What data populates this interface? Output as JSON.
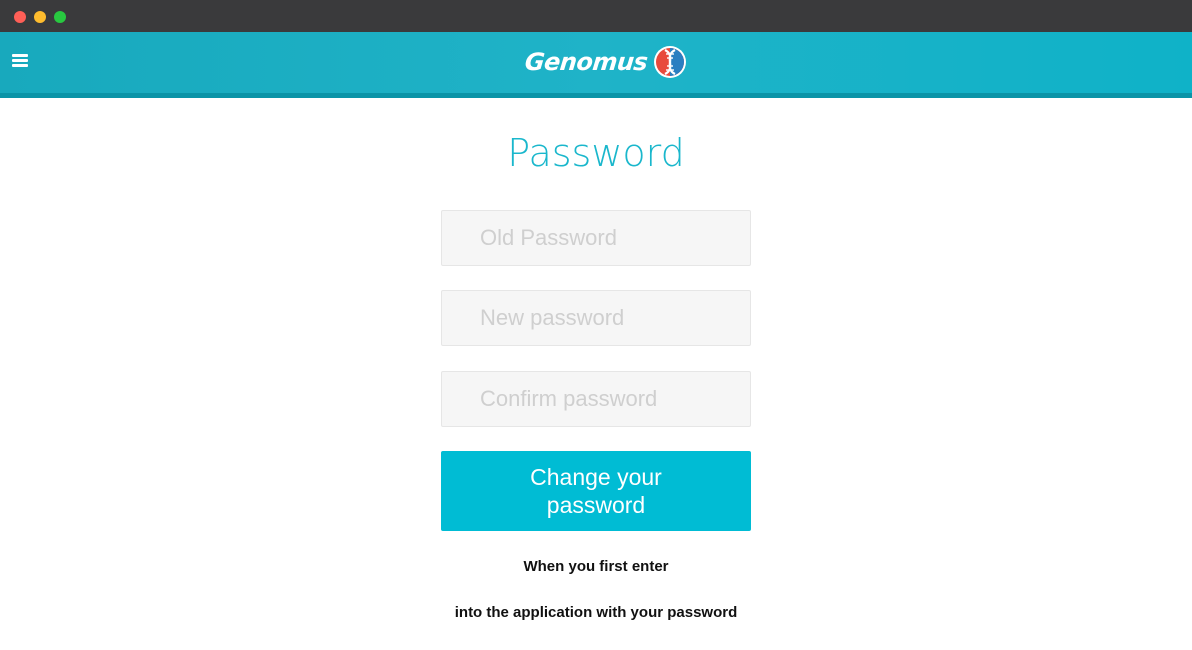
{
  "window": {
    "controls": [
      "close",
      "minimize",
      "maximize"
    ]
  },
  "header": {
    "menu_icon": "hamburger-menu-icon",
    "brand": "Genomus",
    "brand_icon": "dna-icon",
    "color": "#1fb3c8"
  },
  "form": {
    "title": "Password",
    "old_password_placeholder": "Old Password",
    "new_password_placeholder": "New password",
    "confirm_password_placeholder": "Confirm password",
    "submit_label": "Change your password",
    "accent_color": "#00bcd4"
  },
  "notes": {
    "line1": "When you first enter",
    "line2": "into the application with your password"
  }
}
